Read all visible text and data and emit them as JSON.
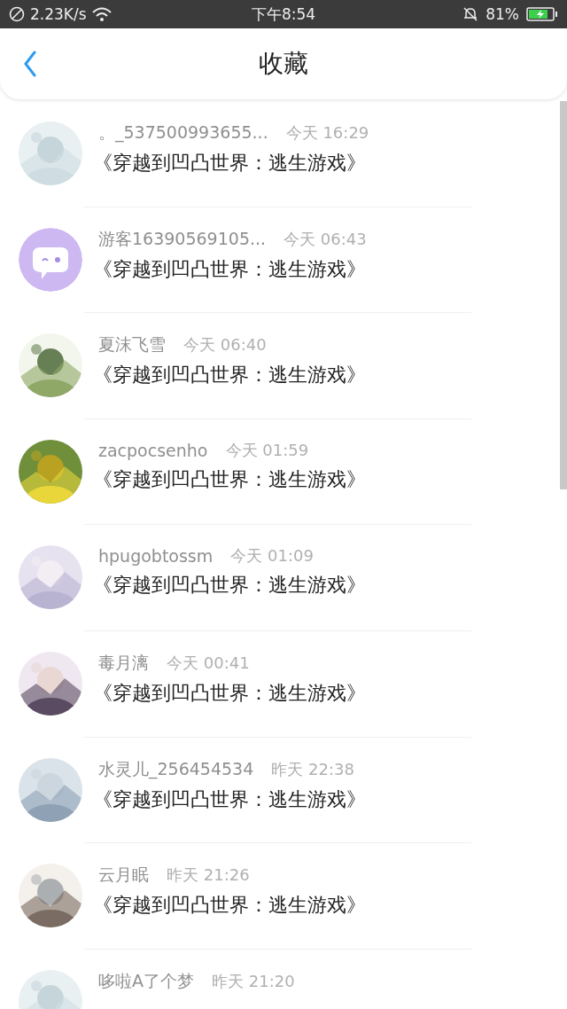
{
  "status_bar": {
    "speed": "2.23K/s",
    "time": "下午8:54",
    "battery": "81%"
  },
  "header": {
    "title": "收藏"
  },
  "items": [
    {
      "avatar": {
        "kind": "placeholder"
      },
      "name": "。_537500993655...",
      "time": "今天 16:29",
      "title": "《穿越到凹凸世界：逃生游戏》"
    },
    {
      "avatar": {
        "kind": "chat-icon"
      },
      "name": "游客16390569105...",
      "time": "今天 06:43",
      "title": "《穿越到凹凸世界：逃生游戏》"
    },
    {
      "name": "夏沫飞雪",
      "time": "今天 06:40",
      "title": "《穿越到凹凸世界：逃生游戏》"
    },
    {
      "name": "zacpocsenho",
      "time": "今天 01:59",
      "title": "《穿越到凹凸世界：逃生游戏》"
    },
    {
      "name": "hpugobtossm",
      "time": "今天 01:09",
      "title": "《穿越到凹凸世界：逃生游戏》"
    },
    {
      "name": "毒月漓",
      "time": "今天 00:41",
      "title": "《穿越到凹凸世界：逃生游戏》"
    },
    {
      "name": "水灵儿_256454534",
      "time": "昨天 22:38",
      "title": "《穿越到凹凸世界：逃生游戏》"
    },
    {
      "name": "云月眠",
      "time": "昨天 21:26",
      "title": "《穿越到凹凸世界：逃生游戏》"
    },
    {
      "name": "哆啦A了个梦",
      "time": "昨天 21:20"
    }
  ]
}
